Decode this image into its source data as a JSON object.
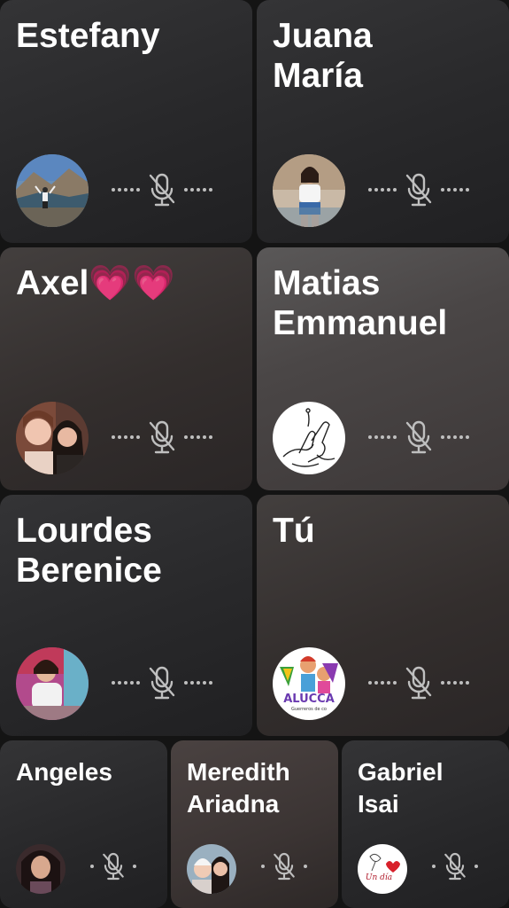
{
  "participants": [
    {
      "name": "Estefany",
      "muted": true,
      "avatar": "person-mountain-lake"
    },
    {
      "name": "Juana\nMaría",
      "muted": true,
      "avatar": "person-standing"
    },
    {
      "name": "Axel💗💗",
      "muted": true,
      "avatar": "two-girls-selfie"
    },
    {
      "name": "Matias\nEmmanuel",
      "muted": true,
      "avatar": "hands-sketch"
    },
    {
      "name": "Lourdes\nBerenice",
      "muted": true,
      "avatar": "girl-portrait-colorful"
    },
    {
      "name": "Tú",
      "muted": true,
      "avatar": "alucca-logo"
    },
    {
      "name": "Angeles",
      "muted": true,
      "avatar": "girl-portrait-dark"
    },
    {
      "name": "Meredith\nAriadna",
      "muted": true,
      "avatar": "two-girls-smiling"
    },
    {
      "name": "Gabriel\nIsai",
      "muted": true,
      "avatar": "heart-sketch"
    }
  ],
  "avatar_text": {
    "alucca": "ALUCCA",
    "alucca_sub": "Guerreros de co",
    "sketch_text": "Un día"
  },
  "colors": {
    "background": "#141414",
    "text": "#ffffff",
    "mic_muted": "#bfbfbf"
  }
}
